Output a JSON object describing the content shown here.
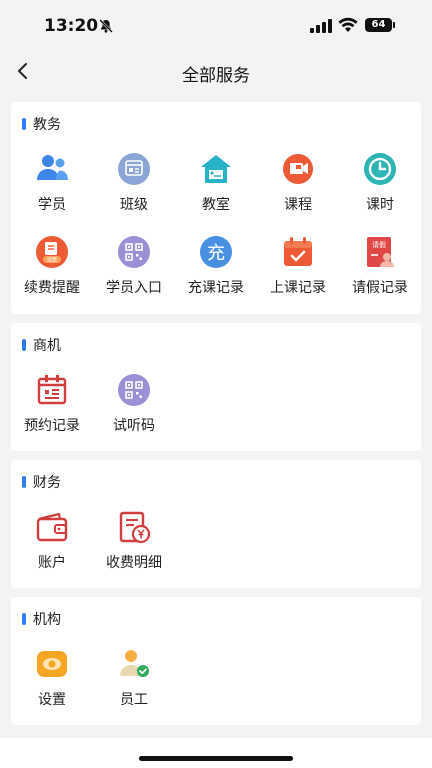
{
  "status": {
    "time": "13:20",
    "battery": "64"
  },
  "nav": {
    "title": "全部服务"
  },
  "sections": [
    {
      "title": "教务",
      "items": [
        {
          "label": "学员",
          "icon": "students-icon"
        },
        {
          "label": "班级",
          "icon": "class-icon"
        },
        {
          "label": "教室",
          "icon": "classroom-icon"
        },
        {
          "label": "课程",
          "icon": "course-icon"
        },
        {
          "label": "课时",
          "icon": "clock-icon"
        },
        {
          "label": "续费提醒",
          "icon": "renewal-icon"
        },
        {
          "label": "学员入口",
          "icon": "qr-icon"
        },
        {
          "label": "充课记录",
          "icon": "recharge-icon"
        },
        {
          "label": "上课记录",
          "icon": "calendar-icon"
        },
        {
          "label": "请假记录",
          "icon": "leave-icon"
        }
      ]
    },
    {
      "title": "商机",
      "items": [
        {
          "label": "预约记录",
          "icon": "appointment-icon"
        },
        {
          "label": "试听码",
          "icon": "trial-qr-icon"
        }
      ]
    },
    {
      "title": "财务",
      "items": [
        {
          "label": "账户",
          "icon": "wallet-icon"
        },
        {
          "label": "收费明细",
          "icon": "bill-icon"
        }
      ]
    },
    {
      "title": "机构",
      "items": [
        {
          "label": "设置",
          "icon": "settings-icon"
        },
        {
          "label": "员工",
          "icon": "staff-icon"
        }
      ]
    }
  ],
  "icon_glyphs": {
    "recharge": "充",
    "leave": "请假",
    "renewal_badge": "续费"
  },
  "colors": {
    "accent": "#2f7cf6",
    "blue": "#4a90e2",
    "purple": "#9b8fd6",
    "orange": "#f26b3a",
    "teal": "#2db5b5",
    "red": "#e04848",
    "green": "#2eaa5c",
    "amber": "#f5a623"
  }
}
